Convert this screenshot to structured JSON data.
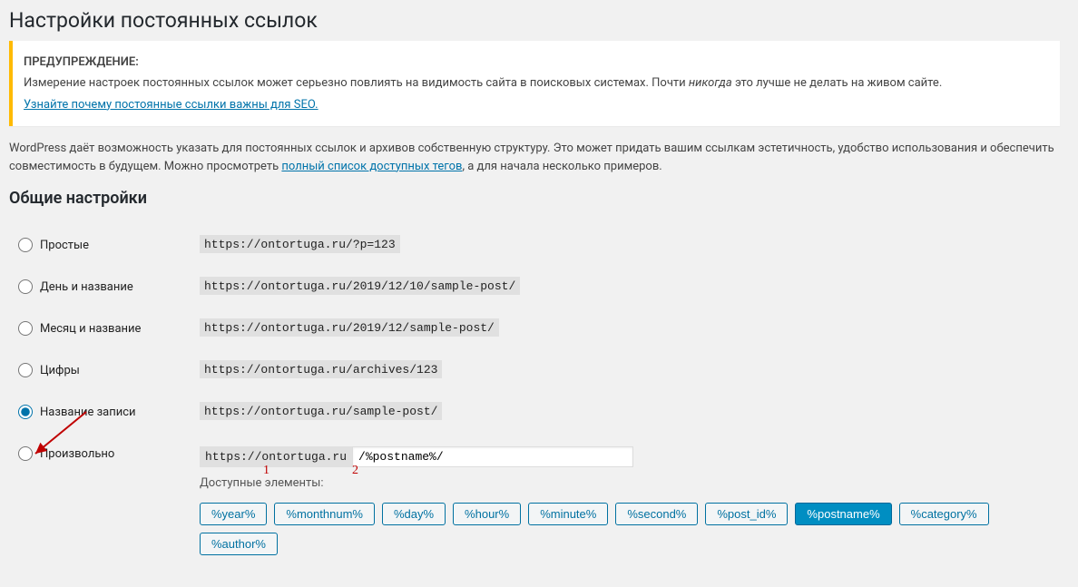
{
  "page_title": "Настройки постоянных ссылок",
  "warning": {
    "title": "ПРЕДУПРЕЖДЕНИЕ:",
    "text_before": "Измерение настроек постоянных ссылок может серьезно повлиять на видимость сайта в поисковых системах. Почти ",
    "text_em": "никогда",
    "text_after": " это лучше не делать на живом сайте.",
    "link": "Узнайте почему постоянные ссылки важны для SEO."
  },
  "intro": {
    "text_before": "WordPress даёт возможность указать для постоянных ссылок и архивов собственную структуру. Это может придать вашим ссылкам эстетичность, удобство использования и обеспечить совместимость в будущем. Можно просмотреть ",
    "link": "полный список доступных тегов",
    "text_after": ", а для начала несколько примеров."
  },
  "section_title": "Общие настройки",
  "options": [
    {
      "id": "plain",
      "label": "Простые",
      "sample": "https://ontortuga.ru/?p=123",
      "checked": false
    },
    {
      "id": "dayname",
      "label": "День и название",
      "sample": "https://ontortuga.ru/2019/12/10/sample-post/",
      "checked": false
    },
    {
      "id": "monthname",
      "label": "Месяц и название",
      "sample": "https://ontortuga.ru/2019/12/sample-post/",
      "checked": false
    },
    {
      "id": "numeric",
      "label": "Цифры",
      "sample": "https://ontortuga.ru/archives/123",
      "checked": false
    },
    {
      "id": "postname",
      "label": "Название записи",
      "sample": "https://ontortuga.ru/sample-post/",
      "checked": true
    },
    {
      "id": "custom",
      "label": "Произвольно",
      "sample": "",
      "checked": false
    }
  ],
  "custom": {
    "base": "https://ontortuga.ru",
    "value": "/%postname%/",
    "available_label": "Доступные элементы:"
  },
  "tags": [
    "%year%",
    "%monthnum%",
    "%day%",
    "%hour%",
    "%minute%",
    "%second%",
    "%post_id%",
    "%postname%",
    "%category%",
    "%author%"
  ],
  "active_tag": "%postname%",
  "annotations": {
    "n1": "1",
    "n2": "2"
  }
}
